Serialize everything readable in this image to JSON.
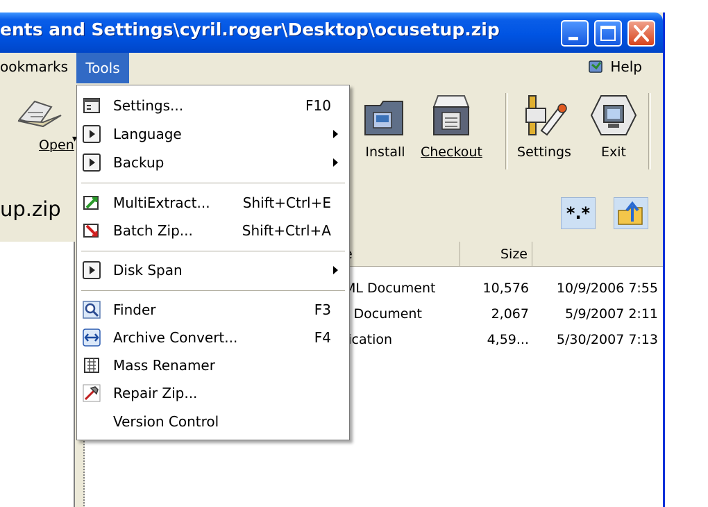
{
  "window": {
    "title": "ents and Settings\\cyril.roger\\Desktop\\ocusetup.zip",
    "path_display": "up.zip"
  },
  "menubar": {
    "bookmarks": "ookmarks",
    "tools": "Tools",
    "help": "Help"
  },
  "toolbar": {
    "open": "Open",
    "install": "Install",
    "checkout": "Checkout",
    "settings": "Settings",
    "exit": "Exit"
  },
  "file_list": {
    "columns": {
      "type": "e",
      "size": "Size"
    },
    "rows": [
      {
        "type": "ML Document",
        "size": "10,576",
        "modified": "10/9/2006 7:55"
      },
      {
        "type": "t Document",
        "size": "2,067",
        "modified": "5/9/2007 2:11"
      },
      {
        "type": "lication",
        "size": "4,59...",
        "modified": "5/30/2007 7:13"
      }
    ]
  },
  "tools_menu": {
    "items": [
      {
        "label": "Settings...",
        "shortcut": "F10",
        "icon": "settings-dialog-icon"
      },
      {
        "label": "Language",
        "shortcut": "",
        "icon": "submenu-play-icon",
        "submenu": true
      },
      {
        "label": "Backup",
        "shortcut": "",
        "icon": "submenu-play-icon",
        "submenu": true
      },
      {
        "label": "MultiExtract...",
        "shortcut": "Shift+Ctrl+E",
        "icon": "multi-extract-icon"
      },
      {
        "label": "Batch Zip...",
        "shortcut": "Shift+Ctrl+A",
        "icon": "batch-zip-icon"
      },
      {
        "label": "Disk Span",
        "shortcut": "",
        "icon": "submenu-play-icon",
        "submenu": true
      },
      {
        "label": "Finder",
        "shortcut": "F3",
        "icon": "magnifier-icon"
      },
      {
        "label": "Archive Convert...",
        "shortcut": "F4",
        "icon": "convert-arrows-icon"
      },
      {
        "label": "Mass Renamer",
        "shortcut": "",
        "icon": "mass-renamer-icon"
      },
      {
        "label": "Repair Zip...",
        "shortcut": "",
        "icon": "repair-hammer-icon"
      },
      {
        "label": "Version Control",
        "shortcut": "",
        "icon": ""
      }
    ]
  }
}
